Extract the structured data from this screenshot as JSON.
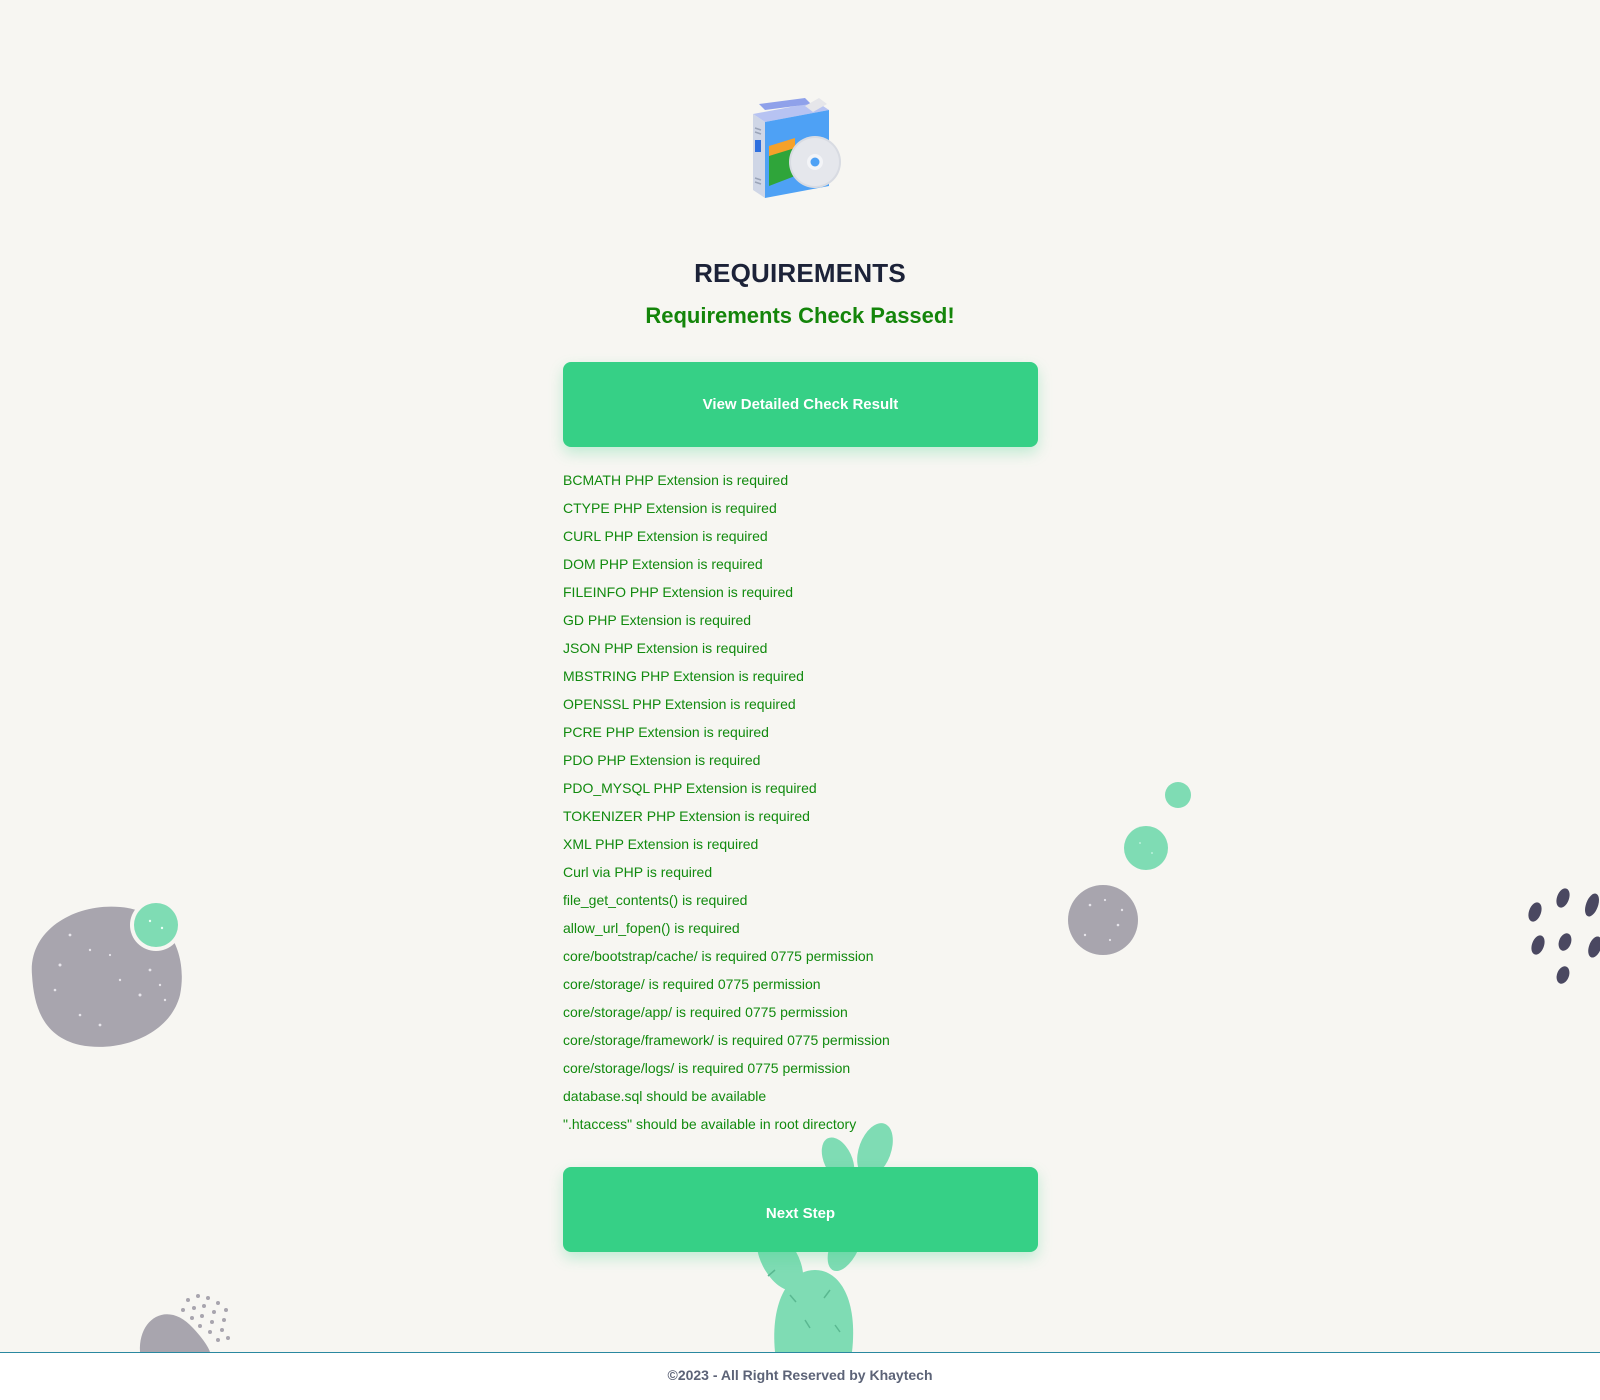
{
  "header": {
    "title": "REQUIREMENTS",
    "status": "Requirements Check Passed!"
  },
  "actions": {
    "detail_label": "View Detailed Check Result",
    "next_label": "Next Step"
  },
  "requirements": [
    "BCMATH PHP Extension is required",
    "CTYPE PHP Extension is required",
    "CURL PHP Extension is required",
    "DOM PHP Extension is required",
    "FILEINFO PHP Extension is required",
    "GD PHP Extension is required",
    "JSON PHP Extension is required",
    "MBSTRING PHP Extension is required",
    "OPENSSL PHP Extension is required",
    "PCRE PHP Extension is required",
    "PDO PHP Extension is required",
    "PDO_MYSQL PHP Extension is required",
    "TOKENIZER PHP Extension is required",
    "XML PHP Extension is required",
    "Curl via PHP is required",
    "file_get_contents() is required",
    "allow_url_fopen() is required",
    "core/bootstrap/cache/ is required 0775 permission",
    "core/storage/ is required 0775 permission",
    "core/storage/app/ is required 0775 permission",
    "core/storage/framework/ is required 0775 permission",
    "core/storage/logs/ is required 0775 permission",
    "database.sql should be available",
    "\".htaccess\" should be available in root directory"
  ],
  "footer": {
    "copyright": "©2023 - All Right Reserved by Khaytech"
  },
  "colors": {
    "background": "#f7f6f2",
    "accent": "#36d086",
    "success_text": "#14850a",
    "title_text": "#1c2238"
  },
  "icons": {
    "logo": "software-box-with-cd-icon"
  }
}
